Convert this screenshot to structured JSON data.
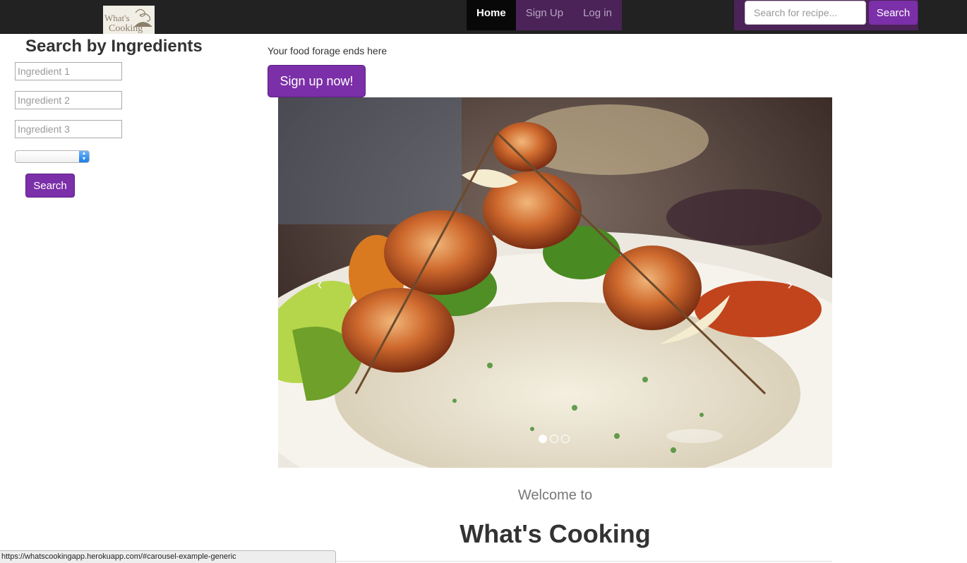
{
  "brand": {
    "logo_text_line1": "What's",
    "logo_text_line2": "Cooking"
  },
  "nav": {
    "links": [
      {
        "label": "Home",
        "active": true
      },
      {
        "label": "Sign Up",
        "active": false
      },
      {
        "label": "Log in",
        "active": false
      }
    ],
    "search": {
      "placeholder": "Search for recipe...",
      "button_label": "Search"
    }
  },
  "sidebar": {
    "title": "Search by Ingredients",
    "ingredients": [
      {
        "placeholder": "Ingredient 1"
      },
      {
        "placeholder": "Ingredient 2"
      },
      {
        "placeholder": "Ingredient 3"
      }
    ],
    "select_value": "",
    "search_label": "Search"
  },
  "main": {
    "tagline": "Your food forage ends here",
    "signup_label": "Sign up now!",
    "carousel": {
      "prev_icon": "chevron-left-icon",
      "next_icon": "chevron-right-icon",
      "slide_count": 3,
      "active_index": 0
    },
    "welcome_pre": "Welcome to",
    "welcome_title": "What's Cooking"
  },
  "status_bar": {
    "url": "https://whatscookingapp.herokuapp.com/#carousel-example-generic"
  },
  "colors": {
    "accent": "#7b2fa8",
    "navbar": "#222222",
    "nav_highlight": "#4b2358"
  }
}
